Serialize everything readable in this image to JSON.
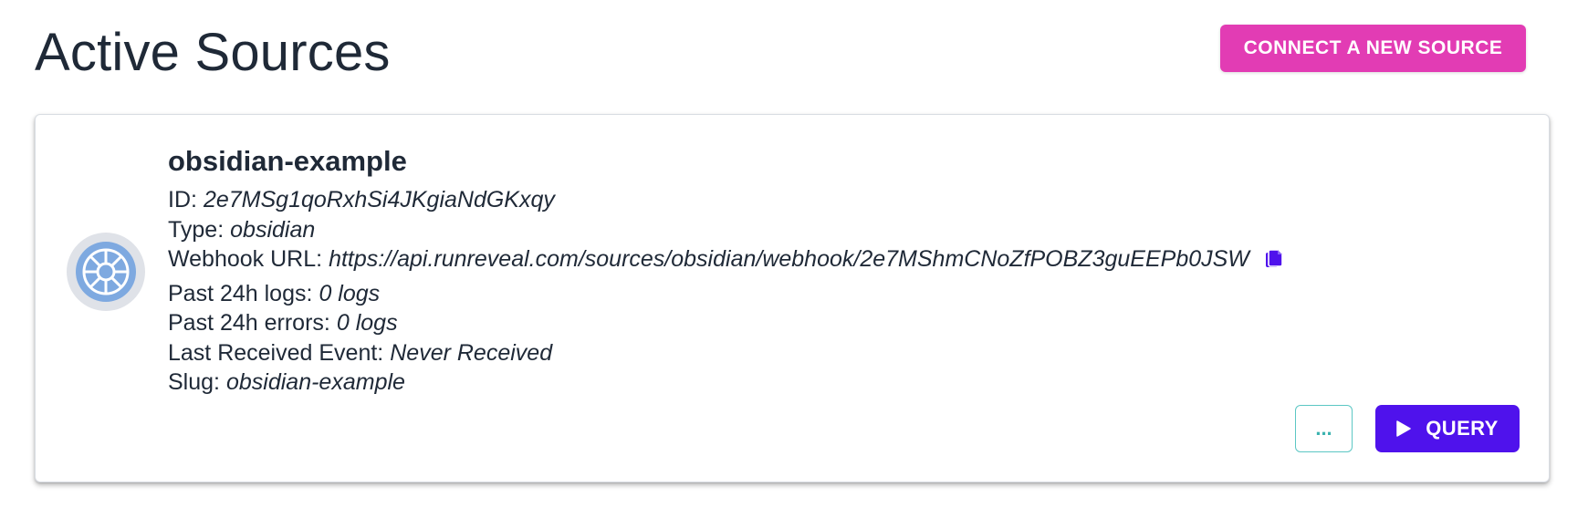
{
  "header": {
    "title": "Active Sources",
    "connect_button_label": "CONNECT A NEW SOURCE"
  },
  "source": {
    "name": "obsidian-example",
    "icon": "obsidian-logo-icon",
    "fields": {
      "id_label": "ID:",
      "id_value": "2e7MSg1qoRxhSi4JKgiaNdGKxqy",
      "type_label": "Type:",
      "type_value": "obsidian",
      "webhook_label": "Webhook URL:",
      "webhook_value": "https://api.runreveal.com/sources/obsidian/webhook/2e7MShmCNoZfPOBZ3guEEPb0JSW",
      "logs_label": "Past 24h logs:",
      "logs_value": "0 logs",
      "errors_label": "Past 24h errors:",
      "errors_value": "0 logs",
      "last_event_label": "Last Received Event:",
      "last_event_value": "Never Received",
      "slug_label": "Slug:",
      "slug_value": "obsidian-example"
    },
    "more_button_label": "...",
    "query_button_label": "QUERY"
  },
  "colors": {
    "connect_button": "#e23cb4",
    "query_button": "#4f12ec",
    "copy_icon": "#4f12ec",
    "more_button_border": "#5cc7c4"
  }
}
